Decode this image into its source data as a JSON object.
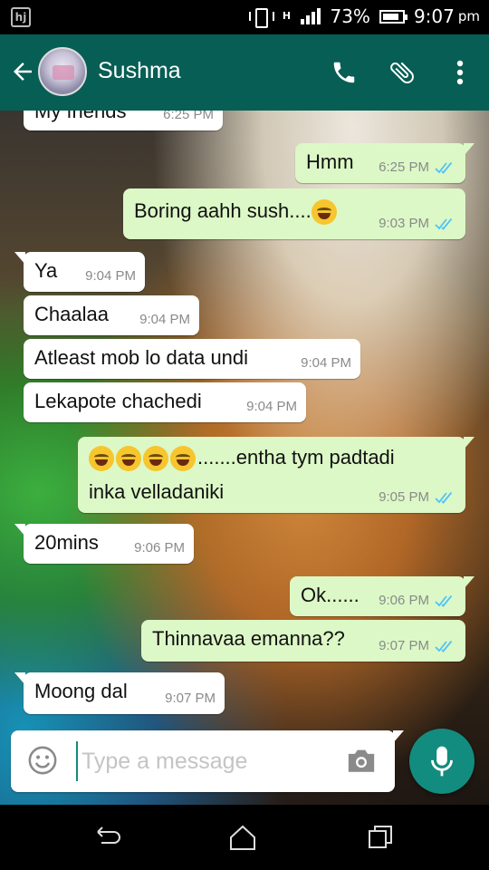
{
  "status_bar": {
    "notification_icon": "hj",
    "network_type": "H",
    "battery": "73%",
    "time": "9:07",
    "ampm": "pm"
  },
  "header": {
    "contact_name": "Sushma",
    "icons": [
      "back-arrow-icon",
      "call-icon",
      "attach-icon",
      "more-vert-icon"
    ]
  },
  "messages": [
    {
      "dir": "in",
      "text": "My friends",
      "time": "6:25 PM"
    },
    {
      "dir": "out",
      "text": "Hmm",
      "time": "6:25 PM"
    },
    {
      "dir": "out",
      "text": "Boring aahh sush....",
      "time": "9:03 PM",
      "emoji": "😂"
    },
    {
      "dir": "in",
      "text": "Ya",
      "time": "9:04 PM"
    },
    {
      "dir": "in",
      "text": "Chaalaa",
      "time": "9:04 PM"
    },
    {
      "dir": "in",
      "text": "Atleast mob lo data undi",
      "time": "9:04 PM"
    },
    {
      "dir": "in",
      "text": "Lekapote chachedi",
      "time": "9:04 PM"
    },
    {
      "dir": "out",
      "text_line1": ".......entha tym padtadi",
      "text_line2": "inka velladaniki",
      "time": "9:05 PM",
      "emoji_count": 4
    },
    {
      "dir": "in",
      "text": "20mins",
      "time": "9:06 PM"
    },
    {
      "dir": "out",
      "text": "Ok......",
      "time": "9:06 PM"
    },
    {
      "dir": "out",
      "text": "Thinnavaa emanna??",
      "time": "9:07 PM"
    },
    {
      "dir": "in",
      "text": "Moong dal",
      "time": "9:07 PM"
    }
  ],
  "composer": {
    "placeholder": "Type a message"
  },
  "colors": {
    "header": "#075e54",
    "outgoing_bubble": "#dcf8c6",
    "incoming_bubble": "#ffffff",
    "fab": "#128c7e",
    "read_tick": "#4fc3f7"
  }
}
